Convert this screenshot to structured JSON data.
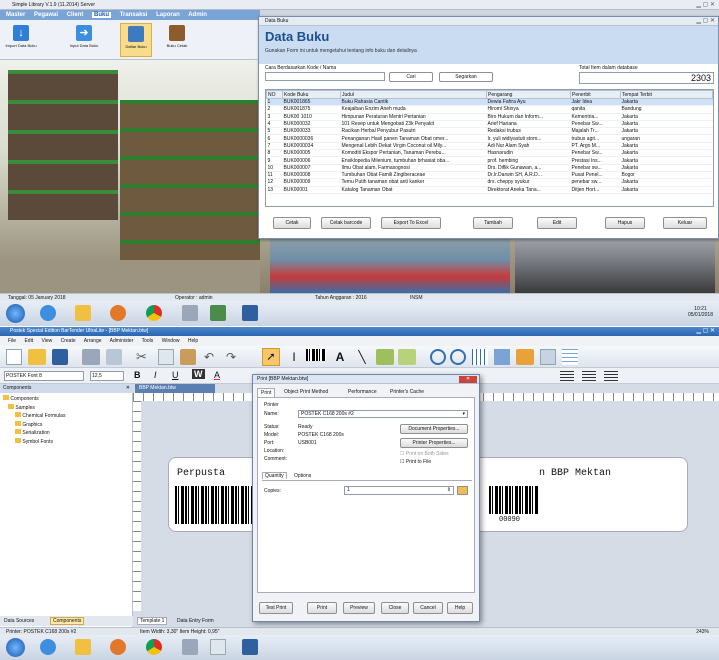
{
  "top": {
    "title": "Simple Library V.1.9 (11.2014) Server",
    "menu": [
      "Master",
      "Pegawai",
      "Client",
      "Buku",
      "Transaksi",
      "Laporan",
      "Admin"
    ],
    "ribbon": [
      "Import Data Buku",
      "Input Data Buku",
      "Daftar Buku",
      "Buku Cetak"
    ],
    "status": {
      "date": "Tanggal: 05 January 2018",
      "operator": "Operator : admin",
      "year": "Tahun Anggaran : 2016",
      "extra": "INSM"
    }
  },
  "dialog": {
    "title": "Data Buku",
    "heading": "Data Buku",
    "subtitle": "Gunakan Form ini untuk mengetahui tentang info buku dan detailnya",
    "search_label": "Cara Berdasarkan Kode / Nama",
    "search_value": "",
    "find_label": "Cari",
    "all_label": "Segarkan",
    "total_label": "Total Item dalam database",
    "total_value": "2303",
    "columns": [
      "NO",
      "Kode Buku",
      "Judul",
      "Pengarang",
      "Penerbit",
      "Tempat Terbit"
    ],
    "rows": [
      [
        "1",
        "BUK001865",
        "Buku Rahasia Cantik",
        "Dewia Fahra Ayu",
        "Jakr Idea",
        "Jakarta"
      ],
      [
        "2",
        "BUK001875",
        "Keajaiban Enzim Aneh muda",
        "Hiromi Shinya",
        "qanita",
        "Bandung"
      ],
      [
        "3",
        "BUK00 1010",
        "Himpunan Peraturan Mentri Pertanian",
        "Biro Hukum dan Inform...",
        "Kementria...",
        "Jakarta"
      ],
      [
        "4",
        "BUK000032",
        "101 Resep untuk Mengobati 23k Penyakit",
        "Arief Hariana",
        "Penebar Sw...",
        "Jakarta"
      ],
      [
        "5",
        "BUK000033",
        "Racikan Herbal Penyubur Pasutri",
        "Redaksi trubus",
        "Majalah Tr...",
        "Jakarta"
      ],
      [
        "6",
        "BUK0000036",
        "Penanganan Hasil panen Tanaman Obat omer...",
        "Ir. yuli widiyastuti stom...",
        "trubus agri...",
        "ungaran"
      ],
      [
        "7",
        "BUK0000034",
        "Mengenal Lebih Dekat Virgin Coconut oil Mily...",
        "Adi Nur Alam Syah",
        "PT. Argo M...",
        "Jakarta"
      ],
      [
        "8",
        "BUK000005",
        "Komoditi Ekspor Pertanian, Tanaman Perebu...",
        "Hasnarudin",
        "Penebar Sw...",
        "Jakarta"
      ],
      [
        "9",
        "BUK000006",
        "Ensiklopedia Milenium, tumbuhan brhasiat oba...",
        "prof. hembing",
        "Prestasi Ins...",
        "Jakarta"
      ],
      [
        "10",
        "BUK000007",
        "Ilmu Obat alam, Farmasognosi",
        "Drs. Diflik Gunawan, a...",
        "Penebar sw...",
        "Jakarta"
      ],
      [
        "11",
        "BUK000008",
        "Tumbuhan Obat Famili Zingiberaceae",
        "Dr.Ir.Darwin SH, A.R.D...",
        "Pusat Penel...",
        "Bogor"
      ],
      [
        "12",
        "BUK000009",
        "Temu Putih tanaman obat anti kanker",
        "drs. cheppy syukur",
        "penebar sw...",
        "Jakarta"
      ],
      [
        "13",
        "BUK00001",
        "Katalog Tanaman Obat",
        "Direktorat Aneka Tana...",
        "Ditjen Hort...",
        "Jakarta"
      ]
    ],
    "buttons": [
      "Cetak",
      "Cetak barcode",
      "Export To Excel",
      "Tambah",
      "Edit",
      "Hapus",
      "Keluar"
    ]
  },
  "taskbar_top": {
    "time": "10:21",
    "date": "05/01/2018"
  },
  "bartender": {
    "title": "Postek Special Edition BarTender UltraLite - [BBP Mektan.btw]",
    "menu": [
      "File",
      "Edit",
      "View",
      "Create",
      "Arrange",
      "Administer",
      "Tools",
      "Window",
      "Help"
    ],
    "font_name": "POSTEK Font 8",
    "font_size": "12,5",
    "fmt": [
      "B",
      "I",
      "U",
      "W",
      "A"
    ],
    "panel_title": "Components",
    "tree": [
      "Components",
      "Samples",
      "Chemical Formulas",
      "Graphics",
      "Serialization",
      "Symbol Fonts"
    ],
    "doc_tab": "BBP Mektan.btw",
    "label_left": "Perpusta",
    "label_right": "n BBP Mektan",
    "barcode_num": "00090",
    "bottom_tabs": [
      "Data Sources",
      "Components"
    ],
    "doc_tabs": [
      "Template 1",
      "Data Entry Form"
    ],
    "status_printer": "Printer: POSTEK C168 200s #2",
    "status_size": "Item Width: 3,30\" Item Height: 0,95\"",
    "zoom": "243%"
  },
  "print": {
    "title": "Print [BBP Mektan.btw]",
    "tabs": [
      "Print",
      "Object Print Method",
      "Performance",
      "Printer's Cache"
    ],
    "group_printer": "Printer",
    "name_label": "Name:",
    "name_value": "POSTEK C168 200s #2",
    "status_label": "Status:",
    "status_value": "Ready",
    "model_label": "Model:",
    "model_value": "POSTEK C168 200s",
    "port_label": "Port:",
    "port_value": "USB001",
    "location_label": "Location:",
    "comment_label": "Comment:",
    "doc_props": "Document Properties...",
    "printer_props": "Printer Properties...",
    "print_file": "Print to File",
    "print_both": "Print on Both Sides",
    "sub_tabs": [
      "Quantity",
      "Options"
    ],
    "copies_label": "Copies:",
    "copies_value": "1",
    "buttons": [
      "Test Print",
      "Print",
      "Preview",
      "Close",
      "Cancel",
      "Help"
    ]
  },
  "colors": {
    "accent": "#1e5aa8",
    "panel": "#dfe5ee",
    "taskbar": "#dfe6f0"
  }
}
